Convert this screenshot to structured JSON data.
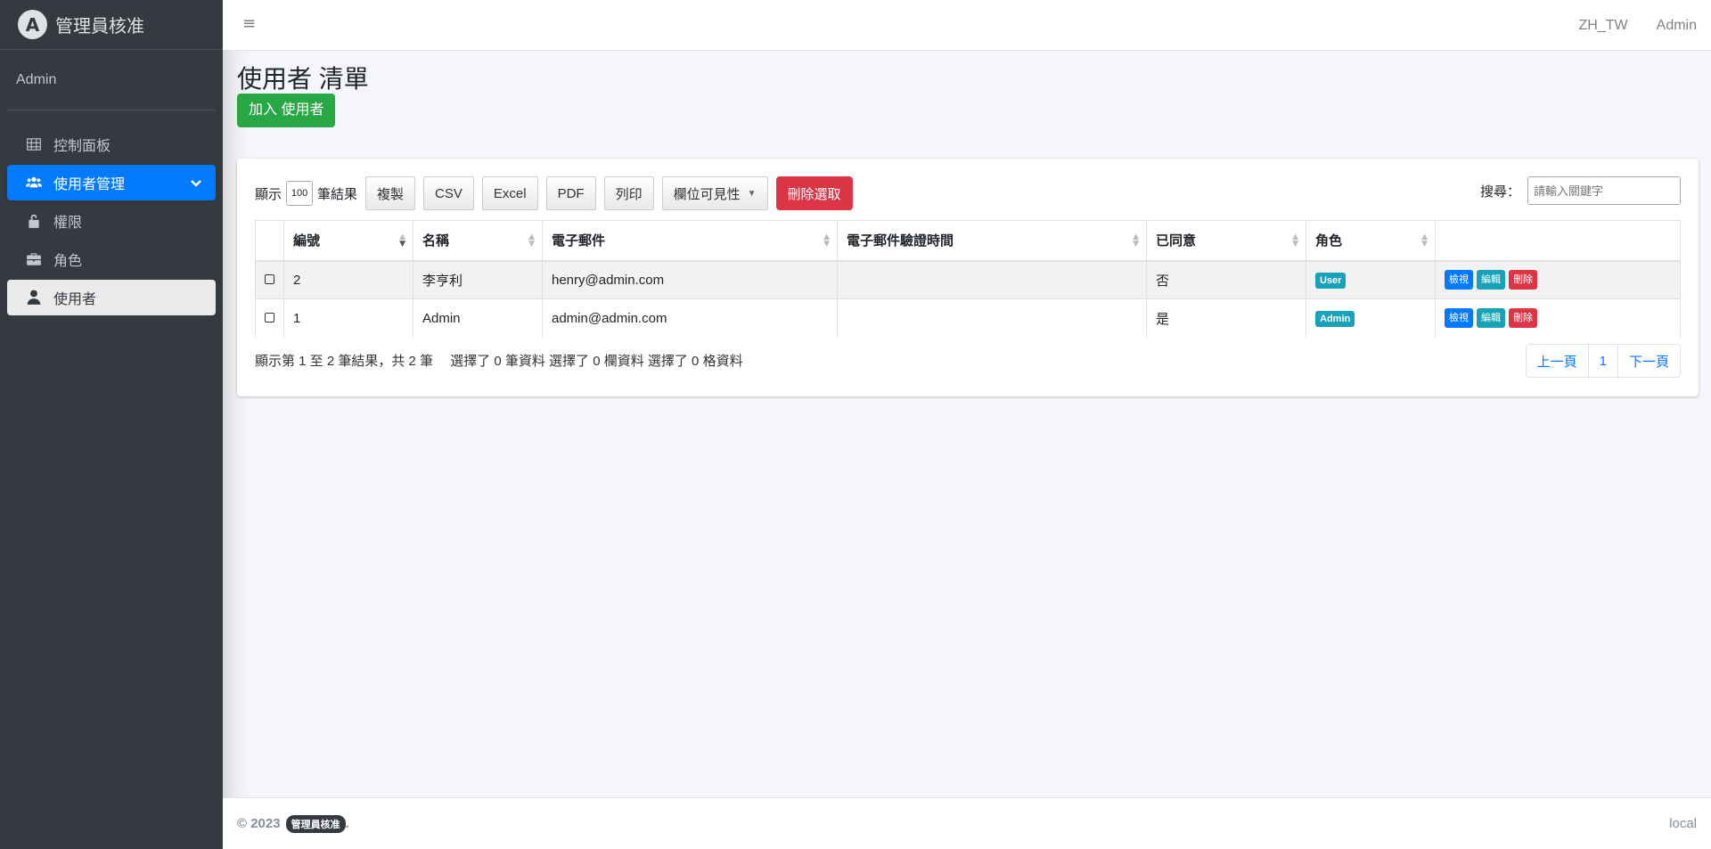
{
  "brand": {
    "logo_letter": "A",
    "name": "管理員核准"
  },
  "user_panel": {
    "name": "Admin"
  },
  "sidebar": {
    "items": [
      {
        "label": "控制面板",
        "icon": "table-icon"
      },
      {
        "label": "使用者管理",
        "icon": "users-icon",
        "active": true
      },
      {
        "label": "權限",
        "icon": "unlock-icon"
      },
      {
        "label": "角色",
        "icon": "briefcase-icon"
      },
      {
        "label": "使用者",
        "icon": "user-icon",
        "current": true
      }
    ]
  },
  "navbar": {
    "menu_glyph": "≡",
    "locale": "ZH_TW",
    "user": "Admin"
  },
  "page": {
    "title": "使用者 清單",
    "add_button": "加入 使用者"
  },
  "toolbar": {
    "show_label": "顯示",
    "page_length": "100",
    "results_label": "筆結果",
    "buttons": [
      "複製",
      "CSV",
      "Excel",
      "PDF",
      "列印",
      "欄位可見性"
    ],
    "delete_selected": "刪除選取",
    "search_label": "搜尋：",
    "search_placeholder": "請輸入關鍵字"
  },
  "table": {
    "headers": [
      "",
      "編號",
      "名稱",
      "電子郵件",
      "電子郵件驗證時間",
      "已同意",
      "角色",
      ""
    ],
    "rows": [
      {
        "id": "2",
        "name": "李亨利",
        "email": "henry@admin.com",
        "verified_at": "",
        "agreed": "否",
        "role": "User"
      },
      {
        "id": "1",
        "name": "Admin",
        "email": "admin@admin.com",
        "verified_at": "",
        "agreed": "是",
        "role": "Admin"
      }
    ],
    "actions": {
      "view": "檢視",
      "edit": "編輯",
      "delete": "刪除"
    }
  },
  "info": "顯示第 1 至 2 筆結果，共 2 筆　 選擇了 0 筆資料  選擇了 0 欄資料  選擇了 0 格資料",
  "pagination": {
    "prev": "上一頁",
    "page": "1",
    "next": "下一頁"
  },
  "footer": {
    "copyright": "© 2023",
    "brand": "管理員核准",
    "right": "local"
  },
  "colors": {
    "sidebar": "#343a40",
    "primary": "#007bff",
    "success": "#28a745",
    "danger": "#dc3545",
    "info": "#17a2b8"
  }
}
